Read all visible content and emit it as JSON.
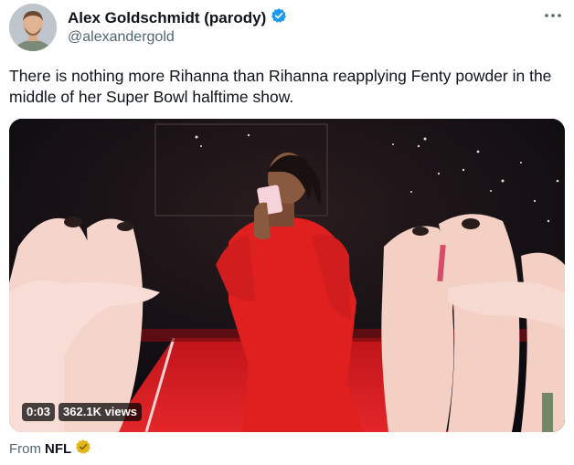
{
  "author": {
    "display_name": "Alex Goldschmidt (parody)",
    "handle": "@alexandergold",
    "verified_color": "#1d9bf0"
  },
  "more_icon": "more-horizontal-icon",
  "tweet": {
    "text": "There is nothing more Rihanna than Rihanna reapplying Fenty powder in the middle of her Super Bowl halftime show."
  },
  "video": {
    "duration": "0:03",
    "views": "362.1K views"
  },
  "source": {
    "prefix": "From",
    "name": "NFL",
    "badge_color": "#e2b719"
  }
}
